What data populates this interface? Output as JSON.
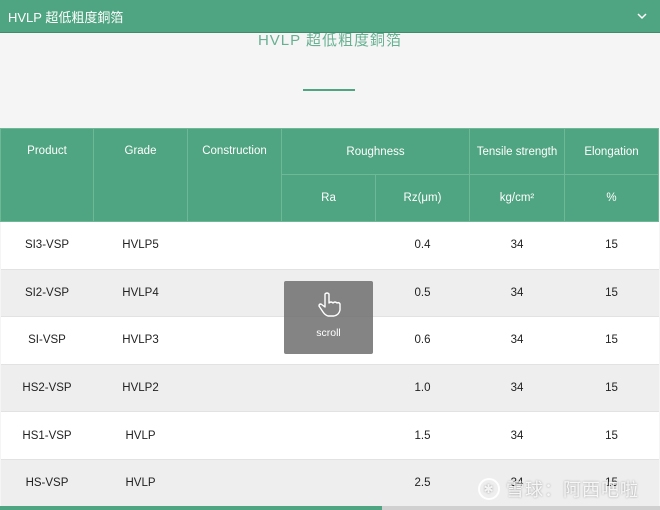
{
  "header": {
    "title": "HVLP 超低粗度銅箔",
    "chevron_icon": "chevron-down-icon"
  },
  "section": {
    "title": "HVLP 超低粗度銅箔"
  },
  "table": {
    "headers": {
      "product": "Product",
      "grade": "Grade",
      "construction": "Construction",
      "roughness": "Roughness",
      "ra": "Ra",
      "rz": "Rz(μm)",
      "tensile": "Tensile strength",
      "tensile_unit": "kg/cm²",
      "elongation": "Elongation",
      "elongation_unit": "%"
    },
    "rows": [
      {
        "product": "SI3-VSP",
        "grade": "HVLP5",
        "construction": "",
        "ra": "",
        "rz": "0.4",
        "tensile": "34",
        "elongation": "15"
      },
      {
        "product": "SI2-VSP",
        "grade": "HVLP4",
        "construction": "",
        "ra": "",
        "rz": "0.5",
        "tensile": "34",
        "elongation": "15"
      },
      {
        "product": "SI-VSP",
        "grade": "HVLP3",
        "construction": "",
        "ra": "",
        "rz": "0.6",
        "tensile": "34",
        "elongation": "15"
      },
      {
        "product": "HS2-VSP",
        "grade": "HVLP2",
        "construction": "",
        "ra": "",
        "rz": "1.0",
        "tensile": "34",
        "elongation": "15"
      },
      {
        "product": "HS1-VSP",
        "grade": "HVLP",
        "construction": "",
        "ra": "",
        "rz": "1.5",
        "tensile": "34",
        "elongation": "15"
      },
      {
        "product": "HS-VSP",
        "grade": "HVLP",
        "construction": "",
        "ra": "",
        "rz": "2.5",
        "tensile": "34",
        "elongation": "15"
      }
    ]
  },
  "scroll_hint": {
    "label": "scroll",
    "icon": "hand-pointer-icon"
  },
  "watermark": {
    "text": "雪球：阿西吧啦",
    "icon": "snowball-logo-icon"
  },
  "colors": {
    "accent": "#4fa481",
    "row_alt": "#eeeeee"
  },
  "horizontal_scroll": {
    "position_fraction": 0.58
  }
}
